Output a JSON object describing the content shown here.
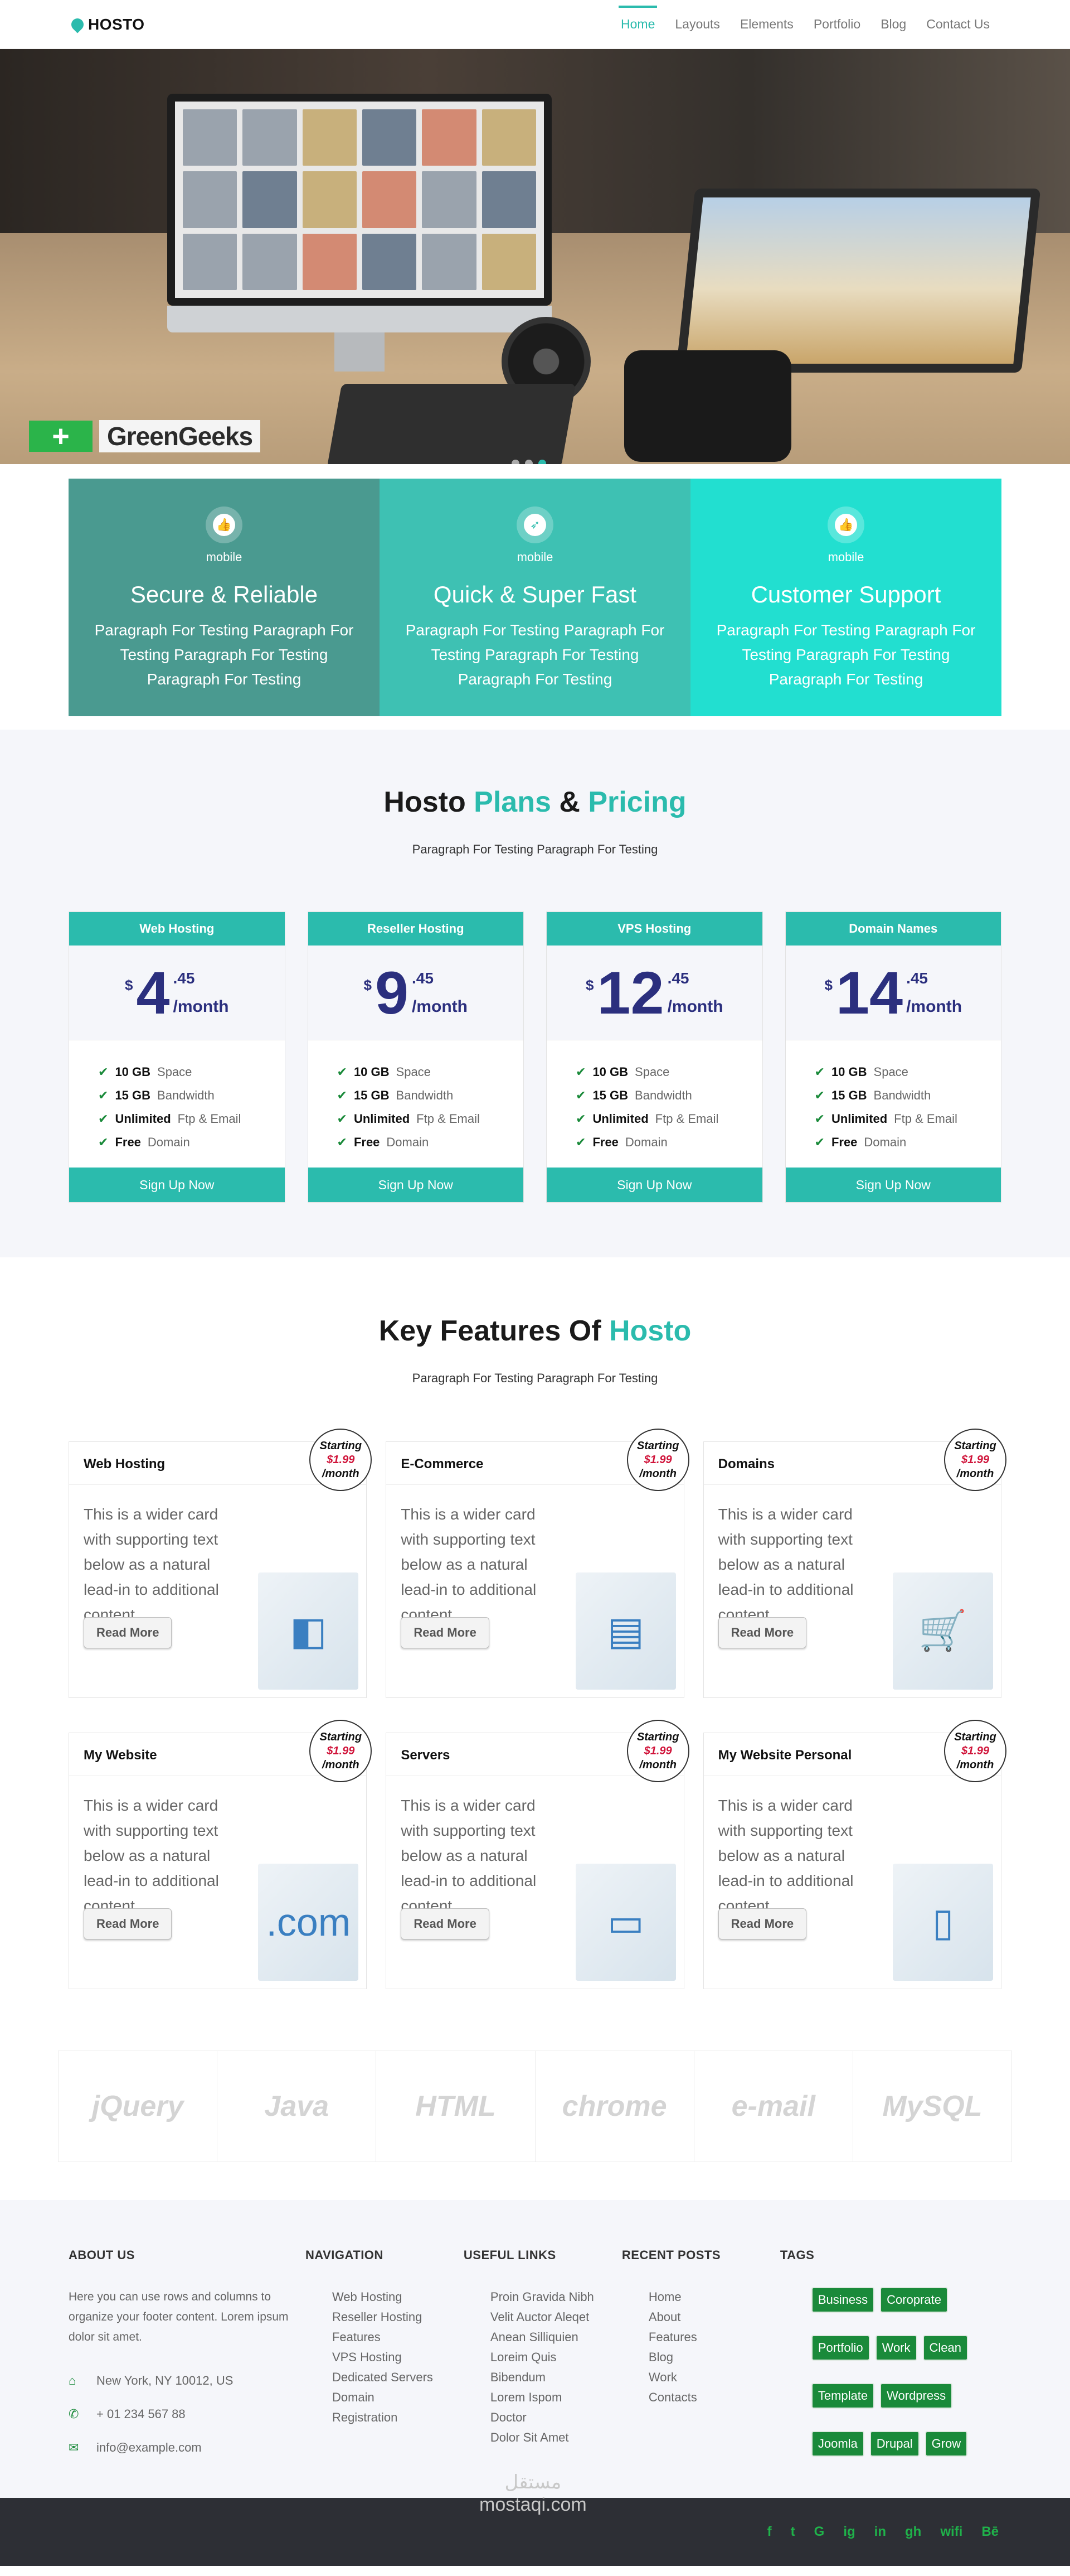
{
  "nav": {
    "brand": "HOSTO",
    "links": [
      "Home",
      "Layouts",
      "Elements",
      "Portfolio",
      "Blog",
      "Contact Us"
    ]
  },
  "hero": {
    "logo_text": "GreenGeeks",
    "logo_mark": "+"
  },
  "features": [
    {
      "icon": "thumbs-up-icon",
      "sub": "mobile",
      "title": "Secure & Reliable",
      "text": "Paragraph For Testing Paragraph For Testing Paragraph For Testing Paragraph For Testing"
    },
    {
      "icon": "rocket-icon",
      "sub": "mobile",
      "title": "Quick & Super Fast",
      "text": "Paragraph For Testing Paragraph For Testing Paragraph For Testing Paragraph For Testing"
    },
    {
      "icon": "thumbs-up-icon",
      "sub": "mobile",
      "title": "Customer Support",
      "text": "Paragraph For Testing Paragraph For Testing Paragraph For Testing Paragraph For Testing"
    }
  ],
  "pricing": {
    "title_a": "Hosto ",
    "title_b": "Plans",
    "title_c": " & ",
    "title_d": "Pricing",
    "sub": "Paragraph For Testing Paragraph For Testing",
    "plans": [
      {
        "name": "Web Hosting",
        "currency": "$",
        "price": "4",
        "cents": ".45",
        "per": "/month",
        "items": [
          [
            "10 GB",
            " Space"
          ],
          [
            "15 GB",
            " Bandwidth"
          ],
          [
            "Unlimited",
            " Ftp & Email"
          ],
          [
            "Free",
            " Domain"
          ]
        ],
        "button": "Sign Up Now"
      },
      {
        "name": "Reseller Hosting",
        "currency": "$",
        "price": "9",
        "cents": ".45",
        "per": "/month",
        "items": [
          [
            "10 GB",
            " Space"
          ],
          [
            "15 GB",
            " Bandwidth"
          ],
          [
            "Unlimited",
            " Ftp & Email"
          ],
          [
            "Free",
            " Domain"
          ]
        ],
        "button": "Sign Up Now"
      },
      {
        "name": "VPS Hosting",
        "currency": "$",
        "price": "12",
        "cents": ".45",
        "per": "/month",
        "items": [
          [
            "10 GB",
            " Space"
          ],
          [
            "15 GB",
            " Bandwidth"
          ],
          [
            "Unlimited",
            " Ftp & Email"
          ],
          [
            "Free",
            " Domain"
          ]
        ],
        "button": "Sign Up Now"
      },
      {
        "name": "Domain Names",
        "currency": "$",
        "price": "14",
        "cents": ".45",
        "per": "/month",
        "items": [
          [
            "10 GB",
            " Space"
          ],
          [
            "15 GB",
            " Bandwidth"
          ],
          [
            "Unlimited",
            " Ftp & Email"
          ],
          [
            "Free",
            " Domain"
          ]
        ],
        "button": "Sign Up Now"
      }
    ]
  },
  "keyfeatures": {
    "title_a": "Key Features Of ",
    "title_b": "Hosto",
    "sub": "Paragraph For Testing Paragraph For Testing",
    "cards": [
      {
        "title": "My Website Personal",
        "badge": [
          "Starting",
          "$1.99",
          "/month"
        ],
        "text": "This is a wider card with supporting text below as a natural lead-in to additional content",
        "button": "Read More",
        "image": "tablet-icon"
      }
    ]
  },
  "kf_cards": [
    {
      "title": "Web Hosting",
      "starting": "Starting",
      "price": "$1.99",
      "per": "/month",
      "text": "This is a wider card with supporting text below as a natural lead-in to additional content",
      "button": "Read More",
      "image_icon": "◧"
    },
    {
      "title": "E-Commerce",
      "starting": "Starting",
      "price": "$1.99",
      "per": "/month",
      "text": "This is a wider card with supporting text below as a natural lead-in to additional content",
      "button": "Read More",
      "image_icon": "▤"
    },
    {
      "title": "Domains",
      "starting": "Starting",
      "price": "$1.99",
      "per": "/month",
      "text": "This is a wider card with supporting text below as a natural lead-in to additional content",
      "button": "Read More",
      "image_icon": "🛒"
    },
    {
      "title": "My Website",
      "starting": "Starting",
      "price": "$1.99",
      "per": "/month",
      "text": "This is a wider card with supporting text below as a natural lead-in to additional content",
      "button": "Read More",
      "image_icon": ".com"
    },
    {
      "title": "Servers",
      "starting": "Starting",
      "price": "$1.99",
      "per": "/month",
      "text": "This is a wider card with supporting text below as a natural lead-in to additional content",
      "button": "Read More",
      "image_icon": "▭"
    },
    {
      "title": "My Website Personal",
      "starting": "Starting",
      "price": "$1.99",
      "per": "/month",
      "text": "This is a wider card with supporting text below as a natural lead-in to additional content",
      "button": "Read More",
      "image_icon": "▯"
    }
  ],
  "logos": [
    "jQuery",
    "Java",
    "HTML",
    "chrome",
    "e-mail",
    "MySQL"
  ],
  "footer": {
    "about": {
      "title": "ABOUT US",
      "text": "Here you can use rows and columns to organize your footer content. Lorem ipsum dolor sit amet.",
      "address": "New York, NY 10012, US",
      "phone": "+ 01 234 567 88",
      "email": "info@example.com"
    },
    "navigation": {
      "title": "NAVIGATION",
      "items": [
        "Web Hosting",
        "Reseller Hosting",
        "Features",
        "VPS Hosting",
        "Dedicated Servers",
        "Domain",
        "Registration"
      ]
    },
    "useful": {
      "title": "USEFUL LINKS",
      "items": [
        "Proin Gravida Nibh",
        "Velit Auctor Aleqet",
        "Anean Silliquien",
        "Loreim Quis",
        "Bibendum",
        "Lorem Ispom",
        "Doctor",
        "Dolor Sit Amet"
      ]
    },
    "posts": {
      "title": "RECENT POSTS",
      "items": [
        "Home",
        "About",
        "Features",
        "Blog",
        "Work",
        "Contacts"
      ]
    },
    "tags": {
      "title": "TAGS",
      "items": [
        "Business",
        "Coroprate",
        "Portfolio",
        "Work",
        "Clean",
        "Template",
        "Wordpress",
        "Joomla",
        "Drupal",
        "Grow"
      ]
    }
  },
  "social": [
    "f",
    "t",
    "G",
    "ig",
    "in",
    "gh",
    "wifi",
    "Bē"
  ],
  "watermark": [
    "مستقل",
    "mostaqi.com"
  ]
}
